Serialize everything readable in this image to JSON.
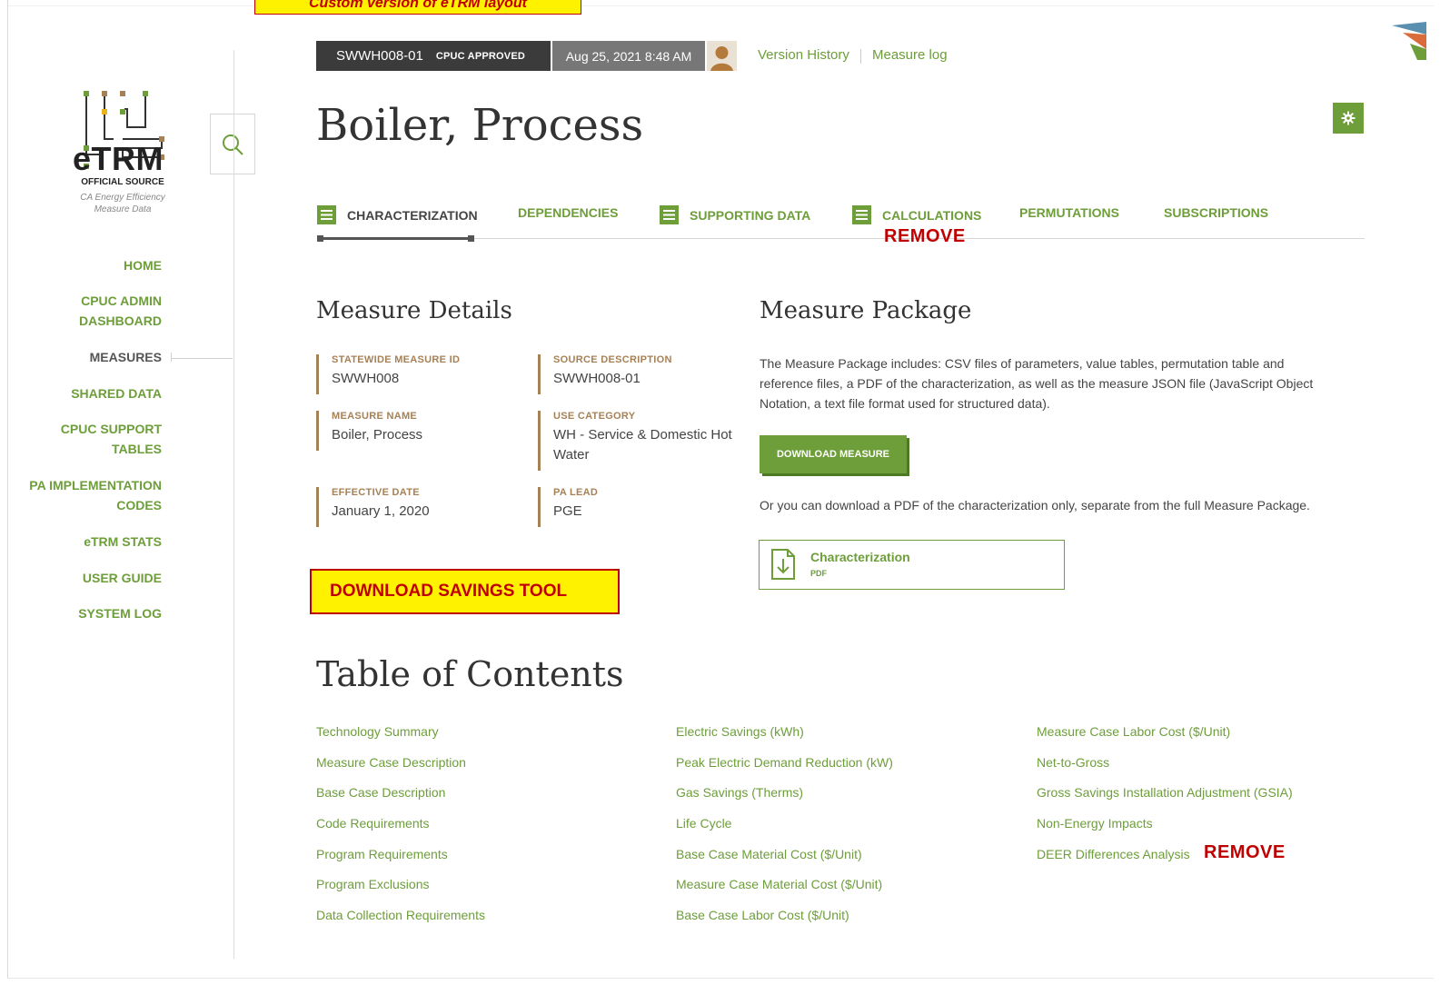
{
  "banner": "Custom version of eTRM layout",
  "sidebar": {
    "logo_title": "eTRM",
    "logo_sub1": "OFFICIAL SOURCE",
    "logo_sub2": "CA Energy Efficiency Measure Data",
    "nav": [
      {
        "label": "HOME"
      },
      {
        "label": "CPUC ADMIN DASHBOARD"
      },
      {
        "label": "MEASURES"
      },
      {
        "label": "SHARED DATA"
      },
      {
        "label": "CPUC SUPPORT TABLES"
      },
      {
        "label": "PA IMPLEMENTATION CODES"
      },
      {
        "label": "eTRM STATS"
      },
      {
        "label": "USER GUIDE"
      },
      {
        "label": "SYSTEM LOG"
      }
    ]
  },
  "header": {
    "measure_version_id": "SWWH008-01",
    "status_badge": "CPUC APPROVED",
    "timestamp": "Aug 25, 2021 8:48 AM",
    "version_history": "Version History",
    "measure_log": "Measure log"
  },
  "page": {
    "title": "Boiler, Process"
  },
  "tabs": [
    {
      "label": "CHARACTERIZATION"
    },
    {
      "label": "DEPENDENCIES"
    },
    {
      "label": "SUPPORTING DATA"
    },
    {
      "label": "CALCULATIONS"
    },
    {
      "label": "PERMUTATIONS"
    },
    {
      "label": "SUBSCRIPTIONS"
    }
  ],
  "remove_label": "REMOVE",
  "measure_details": {
    "title": "Measure Details",
    "fields": [
      {
        "label": "STATEWIDE MEASURE ID",
        "value": "SWWH008"
      },
      {
        "label": "SOURCE DESCRIPTION",
        "value": "SWWH008-01"
      },
      {
        "label": "MEASURE NAME",
        "value": "Boiler, Process"
      },
      {
        "label": "USE CATEGORY",
        "value": "WH - Service & Domestic Hot Water"
      },
      {
        "label": "EFFECTIVE DATE",
        "value": "January 1, 2020"
      },
      {
        "label": "PA LEAD",
        "value": "PGE"
      }
    ],
    "savings_tool": "DOWNLOAD SAVINGS TOOL"
  },
  "measure_package": {
    "title": "Measure Package",
    "description": "The Measure Package includes: CSV files of parameters, value tables, permutation table and reference files, a PDF of the characterization, as well as the measure JSON file (JavaScript Object Notation, a text file format used for structured data).",
    "download_button": "DOWNLOAD MEASURE",
    "pdf_note": "Or you can download a PDF of the characterization only, separate from the full Measure Package.",
    "pdf_card_title": "Characterization",
    "pdf_card_type": "PDF"
  },
  "toc": {
    "title": "Table of Contents",
    "col1": [
      "Technology Summary",
      "Measure Case Description",
      "Base Case Description",
      "Code Requirements",
      "Program Requirements",
      "Program Exclusions",
      "Data Collection Requirements"
    ],
    "col2": [
      "Electric Savings (kWh)",
      "Peak Electric Demand Reduction (kW)",
      "Gas Savings (Therms)",
      "Life Cycle",
      "Base Case Material Cost ($/Unit)",
      "Measure Case Material Cost ($/Unit)",
      "Base Case Labor Cost ($/Unit)"
    ],
    "col3": [
      "Measure Case Labor Cost ($/Unit)",
      "Net-to-Gross",
      "Gross Savings Installation Adjustment (GSIA)",
      "Non-Energy Impacts",
      "DEER Differences Analysis"
    ]
  },
  "colors": {
    "accent_green": "#6d9e3a",
    "detail_brown": "#a68156",
    "annotation_red": "#c00000",
    "annotation_yellow": "#fff200"
  }
}
